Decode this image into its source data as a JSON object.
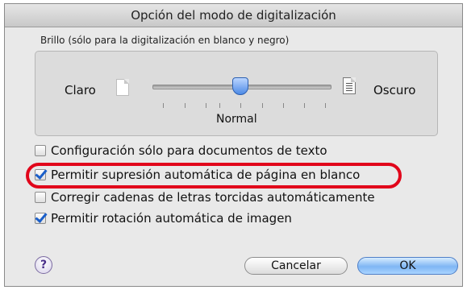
{
  "dialog": {
    "title": "Opción del modo de digitalización"
  },
  "brightness": {
    "group_label": "Brillo (sólo para la digitalización en blanco y negro)",
    "left_label": "Claro",
    "right_label": "Oscuro",
    "value_label": "Normal",
    "left_icon": "light-document-icon",
    "right_icon": "dark-document-icon",
    "slider_position_fraction": 0.5
  },
  "options": [
    {
      "label": "Configuración sólo para documentos de texto",
      "checked": false
    },
    {
      "label": "Permitir supresión automática de página en blanco",
      "checked": true,
      "highlighted": true
    },
    {
      "label": "Corregir cadenas de letras torcidas automáticamente",
      "checked": false
    },
    {
      "label": "Permitir rotación automática de imagen",
      "checked": true
    }
  ],
  "footer": {
    "help_icon": "?",
    "cancel_label": "Cancelar",
    "ok_label": "OK"
  },
  "colors": {
    "highlight": "#e1061b",
    "accent": "#1b5fc9"
  }
}
